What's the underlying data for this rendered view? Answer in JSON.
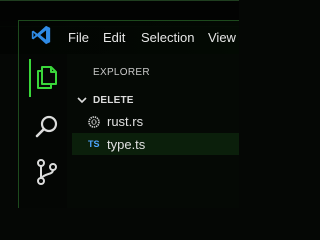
{
  "colors": {
    "accent": "#3ad63a",
    "logo": "#2f8be6",
    "ts_badge": "#4ea7ff",
    "background": "#050705"
  },
  "menu": {
    "logo_icon": "vscode-logo-icon",
    "items": [
      "File",
      "Edit",
      "Selection",
      "View"
    ]
  },
  "activitybar": {
    "icons": [
      "files-icon",
      "search-icon",
      "source-control-icon"
    ],
    "active": "files-icon"
  },
  "sidebar": {
    "title": "EXPLORER",
    "folder": {
      "name": "DELETE",
      "expanded": true
    },
    "files": [
      {
        "name": "rust.rs",
        "icon": "rust-icon"
      },
      {
        "name": "type.ts",
        "icon": "typescript-icon",
        "badge": "TS",
        "selected": true
      }
    ]
  }
}
